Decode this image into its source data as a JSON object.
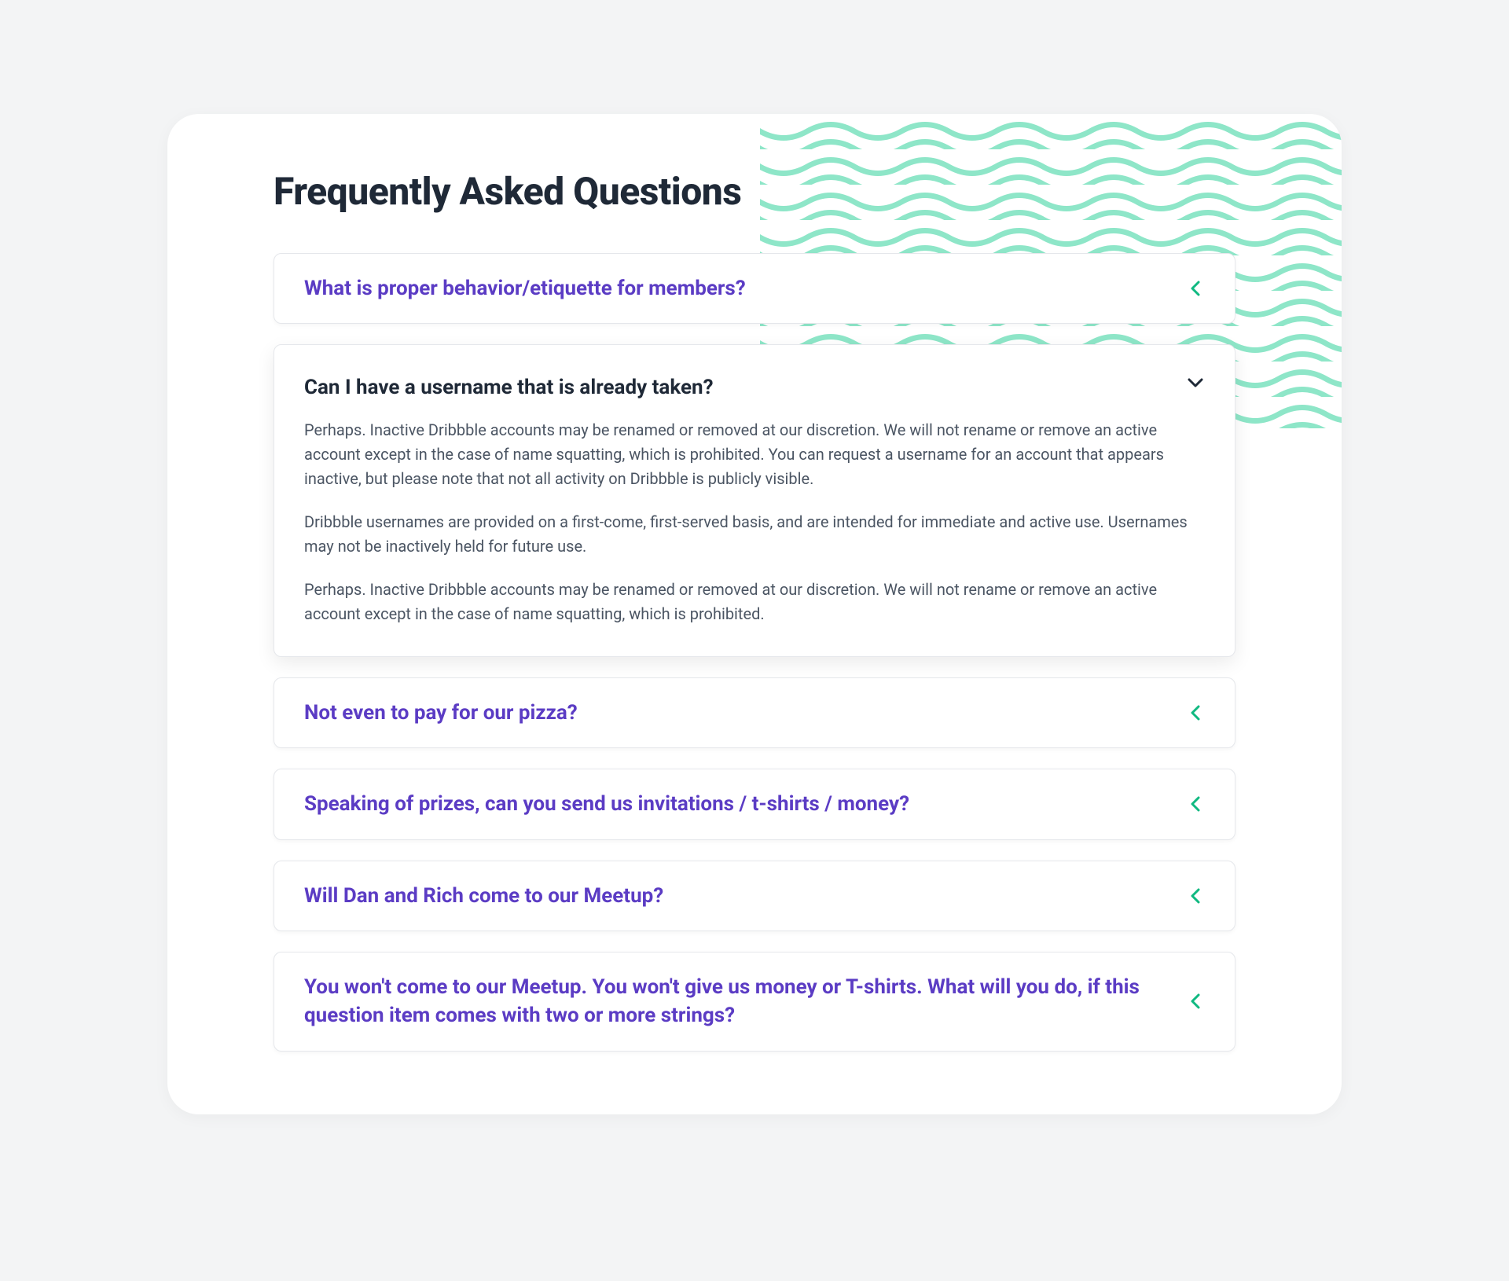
{
  "page_title": "Frequently Asked Questions",
  "colors": {
    "accent_purple": "#5b3cc4",
    "accent_teal": "#10b981",
    "text_dark": "#1f2937",
    "text_body": "#4b5563"
  },
  "faq_items": [
    {
      "question": "What is proper behavior/etiquette for members?",
      "expanded": false
    },
    {
      "question": "Can I have a username that is already taken?",
      "expanded": true,
      "answer_p1": "Perhaps. Inactive Dribbble accounts may be renamed or removed at our discretion. We will not rename or remove an active account except in the case of name squatting, which is prohibited. You can request a username for an account that appears inactive, but please note that not all activity on Dribbble is publicly visible.",
      "answer_p2": "Dribbble usernames are provided on a first-come, first-served basis, and are intended for immediate and active use. Usernames may not be inactively held for future use.",
      "answer_p3": "Perhaps. Inactive Dribbble accounts may be renamed or removed at our discretion. We will not rename or remove an active account except in the case of name squatting, which is prohibited."
    },
    {
      "question": "Not even to pay for our pizza?",
      "expanded": false
    },
    {
      "question": "Speaking of prizes, can you send us invitations / t-shirts / money?",
      "expanded": false
    },
    {
      "question": "Will Dan and Rich come to our Meetup?",
      "expanded": false
    },
    {
      "question": "You won't come to our Meetup. You won't give us money or T-shirts. What will you do, if this question item comes with two or more strings?",
      "expanded": false
    }
  ]
}
